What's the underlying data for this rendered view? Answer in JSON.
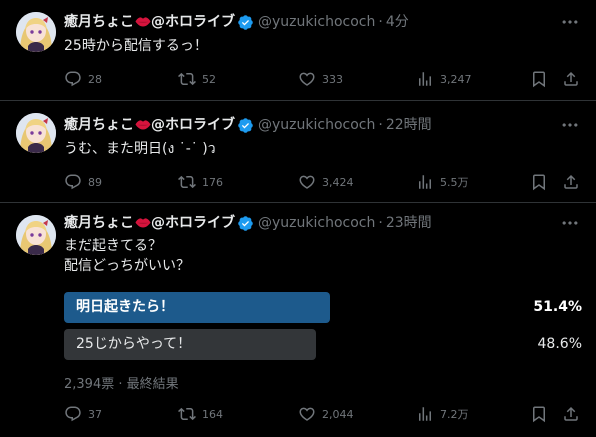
{
  "colors": {
    "background": "#000000",
    "text_primary": "#e7e9ea",
    "text_secondary": "#71767b",
    "divider": "#2f3336",
    "verified_blue": "#1d9bf0",
    "poll_winner": "#1d5a8c",
    "poll_other": "#333639"
  },
  "tweets": [
    {
      "display_name": "癒月ちょこ",
      "name_suffix": "@ホロライブ",
      "handle": "@yuzukichococh",
      "dot": "·",
      "time": "4分",
      "text": "25時から配信するっ！",
      "replies": "28",
      "retweets": "52",
      "likes": "333",
      "views": "3,247"
    },
    {
      "display_name": "癒月ちょこ",
      "name_suffix": "@ホロライブ",
      "handle": "@yuzukichococh",
      "dot": "·",
      "time": "22時間",
      "text": "うむ、また明日(ง ˙-˙ )ว",
      "replies": "89",
      "retweets": "176",
      "likes": "3,424",
      "views": "5.5万"
    },
    {
      "display_name": "癒月ちょこ",
      "name_suffix": "@ホロライブ",
      "handle": "@yuzukichococh",
      "dot": "·",
      "time": "23時間",
      "text": "まだ起きてる？\n配信どっちがいい？",
      "replies": "37",
      "retweets": "164",
      "likes": "2,044",
      "views": "7.2万",
      "poll": {
        "options": [
          {
            "label": "明日起きたら！",
            "percent": "51.4%",
            "fraction": 0.514,
            "winner": true
          },
          {
            "label": "25じからやって！",
            "percent": "48.6%",
            "fraction": 0.486,
            "winner": false
          }
        ],
        "votes": "2,394票",
        "separator": "·",
        "status": "最終結果"
      }
    }
  ],
  "icons": {
    "reply": "reply-icon",
    "retweet": "retweet-icon",
    "like": "heart-icon",
    "views": "views-icon",
    "bookmark": "bookmark-icon",
    "share": "share-icon",
    "more": "more-icon",
    "verified": "verified-badge-icon",
    "lips": "lips-emoji-icon"
  }
}
